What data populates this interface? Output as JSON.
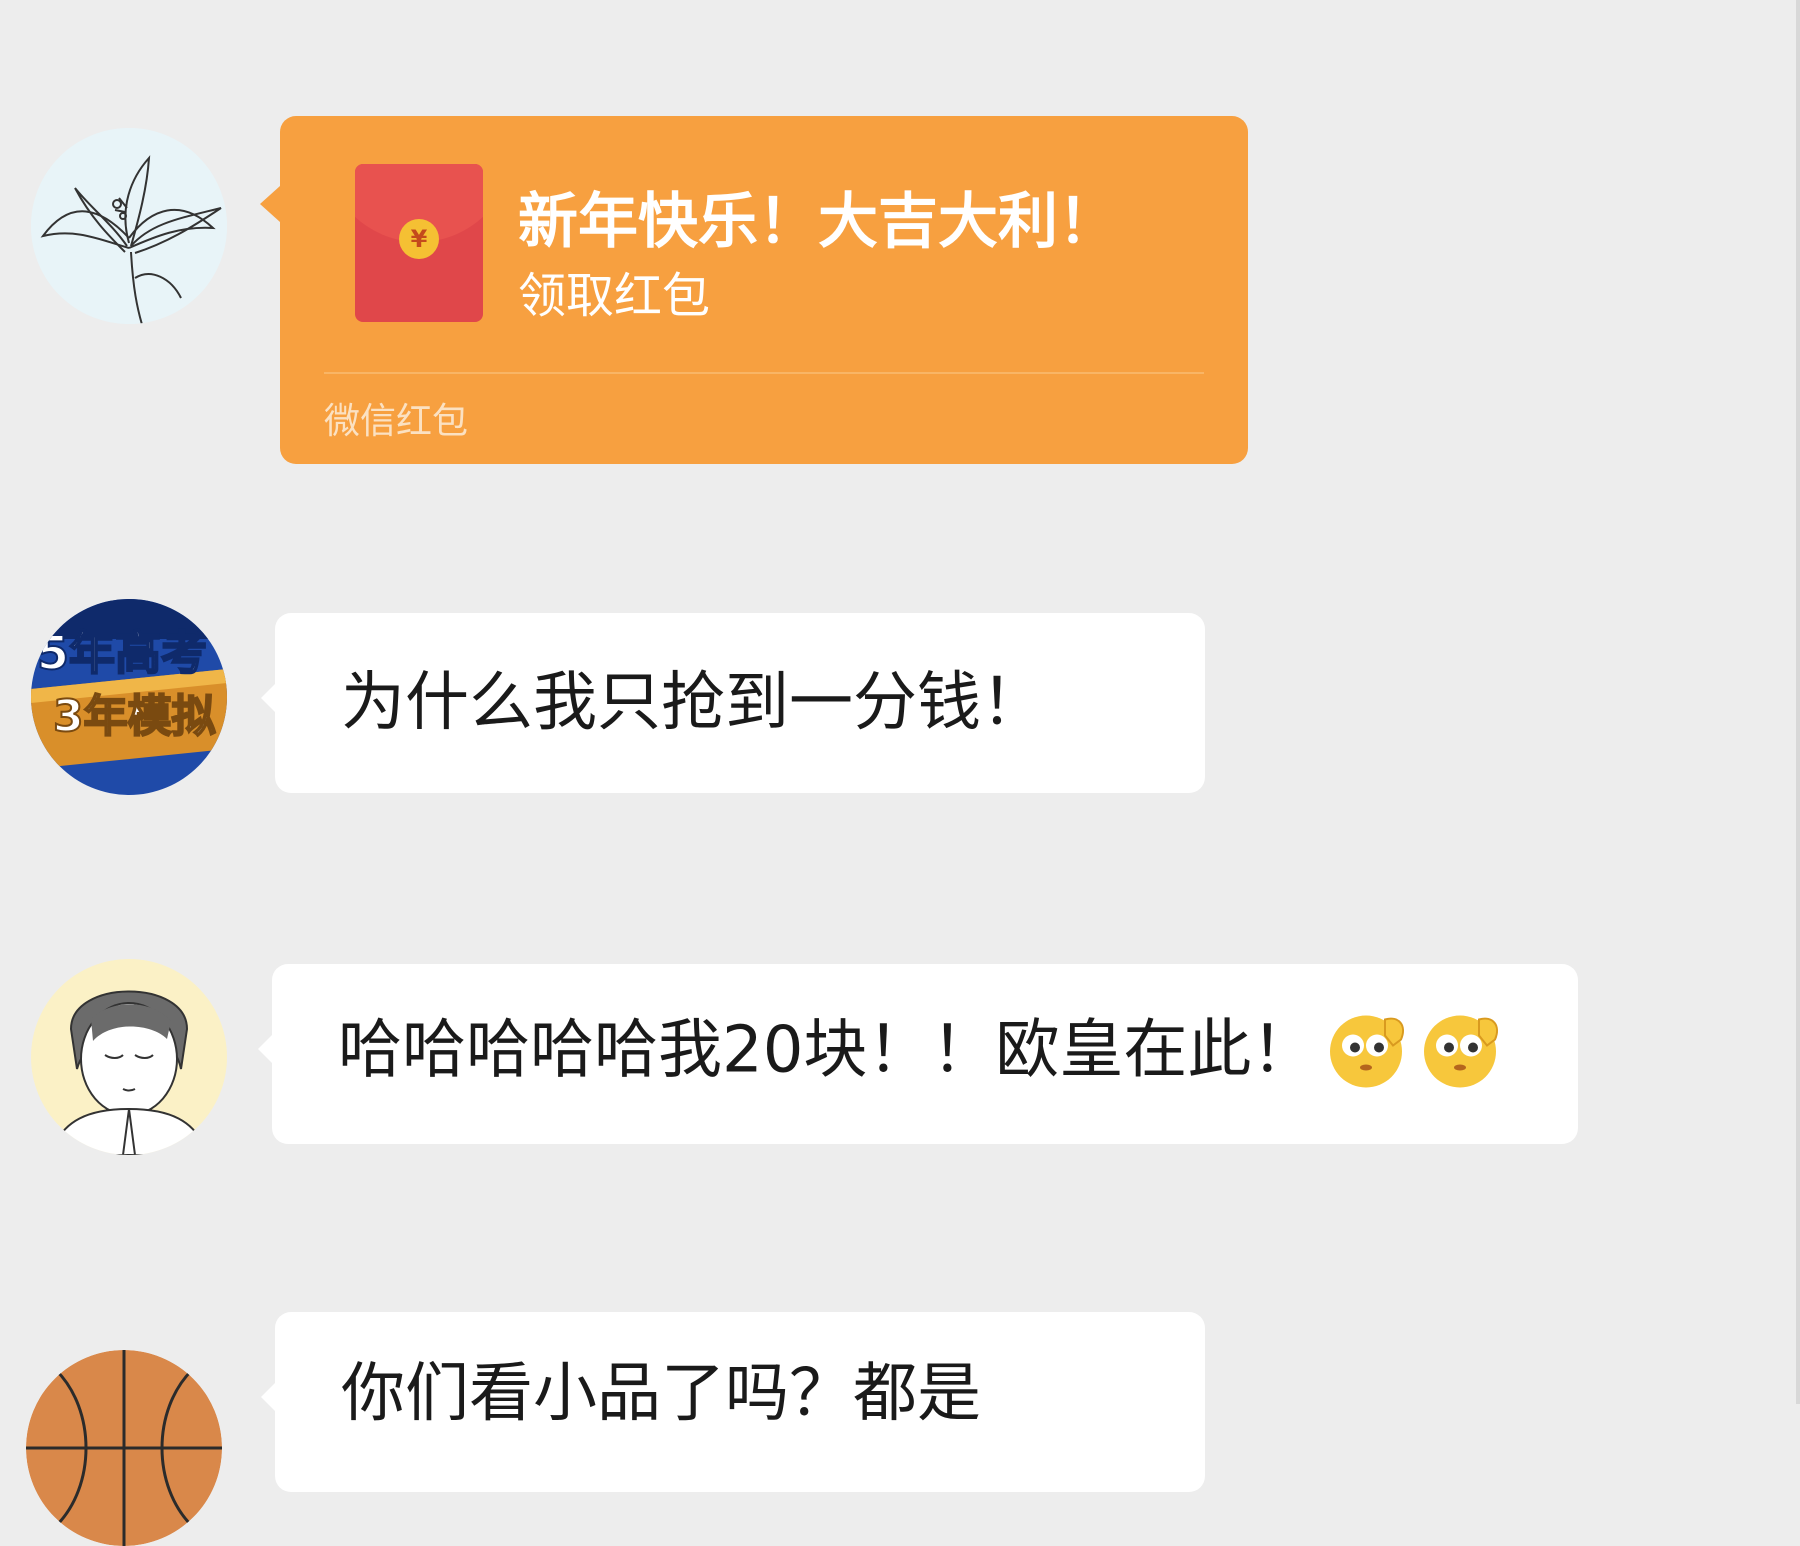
{
  "messages": [
    {
      "type": "red_packet",
      "avatar": "lily-flower-sketch",
      "title": "新年快乐！大吉大利！",
      "subtitle": "领取红包",
      "footer": "微信红包",
      "coin_symbol": "¥"
    },
    {
      "type": "text",
      "avatar": "5-year-gaokao-3-year-simulation-book",
      "text": "为什么我只抢到一分钱！"
    },
    {
      "type": "text",
      "avatar": "praying-anime-boy",
      "text": "哈哈哈哈哈我20块！！欧皇在此！",
      "emojis": [
        "salute-emoji",
        "salute-emoji"
      ]
    },
    {
      "type": "text",
      "avatar": "basketball",
      "text": "你们看小品了吗？都是"
    }
  ],
  "colors": {
    "background": "#ededed",
    "bubble": "#ffffff",
    "red_packet": "#f7a040",
    "envelope": "#e0474a"
  }
}
